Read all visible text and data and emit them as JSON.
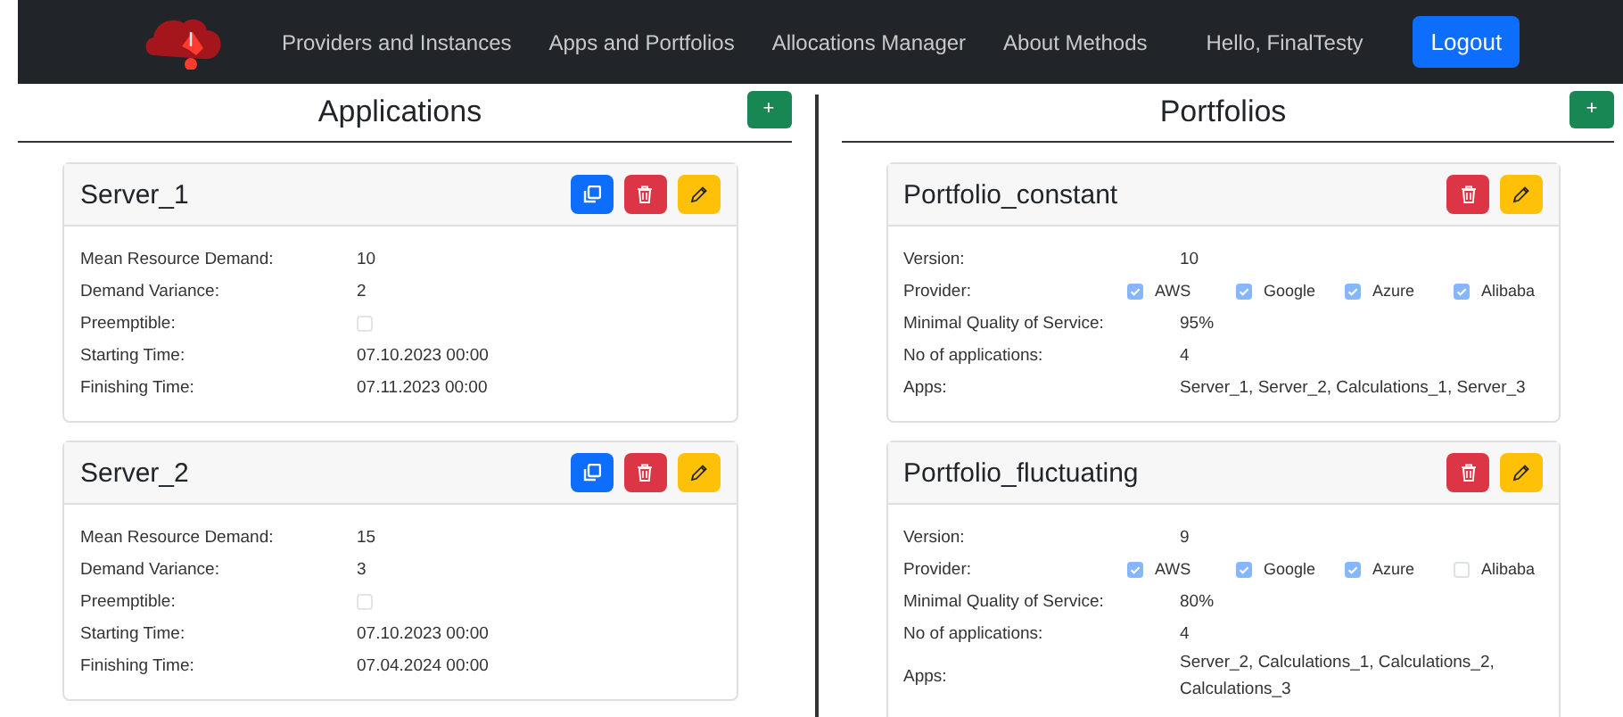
{
  "navbar": {
    "links": [
      "Providers and Instances",
      "Apps and Portfolios",
      "Allocations Manager",
      "About Methods"
    ],
    "greeting": "Hello, FinalTesty",
    "logout": "Logout"
  },
  "applications": {
    "title": "Applications",
    "add_button": "+",
    "items": [
      {
        "name": "Server_1",
        "rows": [
          {
            "label": "Mean Resource Demand:",
            "kind": "text",
            "value": "10"
          },
          {
            "label": "Demand Variance:",
            "kind": "text",
            "value": "2"
          },
          {
            "label": "Preemptible:",
            "kind": "checkbox",
            "checked": false
          },
          {
            "label": "Starting Time:",
            "kind": "text",
            "value": "07.10.2023 00:00"
          },
          {
            "label": "Finishing Time:",
            "kind": "text",
            "value": "07.11.2023 00:00"
          }
        ]
      },
      {
        "name": "Server_2",
        "rows": [
          {
            "label": "Mean Resource Demand:",
            "kind": "text",
            "value": "15"
          },
          {
            "label": "Demand Variance:",
            "kind": "text",
            "value": "3"
          },
          {
            "label": "Preemptible:",
            "kind": "checkbox",
            "checked": false
          },
          {
            "label": "Starting Time:",
            "kind": "text",
            "value": "07.10.2023 00:00"
          },
          {
            "label": "Finishing Time:",
            "kind": "text",
            "value": "07.04.2024 00:00"
          }
        ]
      }
    ]
  },
  "portfolios": {
    "title": "Portfolios",
    "add_button": "+",
    "items": [
      {
        "name": "Portfolio_constant",
        "rows": [
          {
            "label": "Version:",
            "kind": "text",
            "value": "10"
          },
          {
            "label": "Provider:",
            "kind": "providers",
            "providers": [
              {
                "name": "AWS",
                "checked": true
              },
              {
                "name": "Google",
                "checked": true
              },
              {
                "name": "Azure",
                "checked": true
              },
              {
                "name": "Alibaba",
                "checked": true
              }
            ]
          },
          {
            "label": "Minimal Quality of Service:",
            "kind": "text",
            "value": "95%"
          },
          {
            "label": "No of applications:",
            "kind": "text",
            "value": "4"
          },
          {
            "label": "Apps:",
            "kind": "text",
            "value": "Server_1, Server_2, Calculations_1, Server_3"
          }
        ]
      },
      {
        "name": "Portfolio_fluctuating",
        "rows": [
          {
            "label": "Version:",
            "kind": "text",
            "value": "9"
          },
          {
            "label": "Provider:",
            "kind": "providers",
            "providers": [
              {
                "name": "AWS",
                "checked": true
              },
              {
                "name": "Google",
                "checked": true
              },
              {
                "name": "Azure",
                "checked": true
              },
              {
                "name": "Alibaba",
                "checked": false
              }
            ]
          },
          {
            "label": "Minimal Quality of Service:",
            "kind": "text",
            "value": "80%"
          },
          {
            "label": "No of applications:",
            "kind": "text",
            "value": "4"
          },
          {
            "label": "Apps:",
            "kind": "text",
            "value": "Server_2, Calculations_1, Calculations_2, Calculations_3"
          }
        ]
      }
    ]
  }
}
